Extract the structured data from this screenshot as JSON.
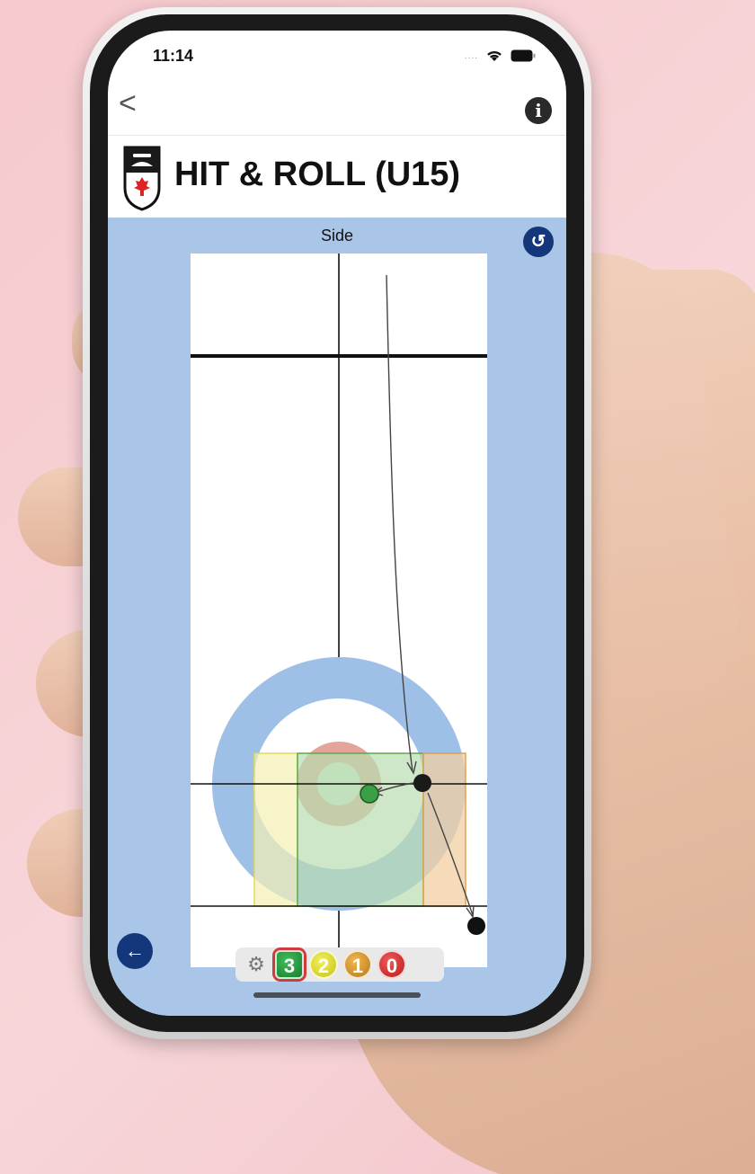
{
  "status_bar": {
    "time": "11:14",
    "signal_dots": "....",
    "wifi_icon": "wifi-icon",
    "battery_icon": "battery-icon"
  },
  "nav": {
    "back_glyph": "<",
    "info_glyph": "i"
  },
  "header": {
    "title": "HIT & ROLL (U15)",
    "logo": "canada-curling-logo"
  },
  "board": {
    "side_label": "Side",
    "colors": {
      "twelve_foot": "#9fc0e6",
      "four_foot": "#e3a49a",
      "button": "#d7ead6",
      "sheet": "#ffffff",
      "background": "#a9c6e8",
      "zone_yellow": "#f5f0b4",
      "zone_green": "#b8ddb0",
      "zone_orange": "#f2cfa1"
    },
    "stones": [
      "black stone (shooter)",
      "green stone (target)",
      "black stone (rolled out)"
    ]
  },
  "toolbar": {
    "gear_icon": "gear-icon",
    "scores": [
      "3",
      "2",
      "1",
      "0"
    ],
    "selected_score": "3"
  }
}
